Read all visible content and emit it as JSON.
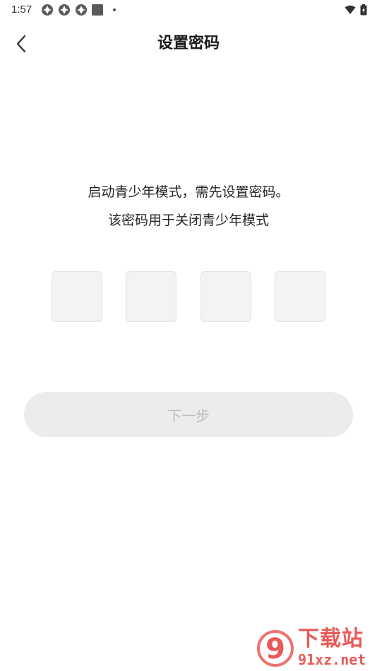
{
  "status_bar": {
    "time": "1:57",
    "notification_icons": [
      "app-notification-icon",
      "app-notification-icon",
      "app-notification-icon",
      "gallery-icon",
      "more-dot-icon"
    ],
    "right_icons": [
      "wifi-icon",
      "battery-charging-icon"
    ]
  },
  "header": {
    "back_icon": "chevron-left-icon",
    "title": "设置密码"
  },
  "description": {
    "line1": "启动青少年模式，需先设置密码。",
    "line2": "该密码用于关闭青少年模式"
  },
  "pin": {
    "length": 4,
    "values": [
      "",
      "",
      "",
      ""
    ]
  },
  "actions": {
    "next_label": "下一步",
    "next_enabled": false
  },
  "watermark": {
    "logo_text": "9",
    "brand": "下载站",
    "url": "91xz.net"
  },
  "colors": {
    "background": "#ffffff",
    "pin_box_fill": "#f3f3f3",
    "button_disabled_fill": "#ececec",
    "button_disabled_text": "#bdbdbd",
    "watermark": "#e85a57"
  }
}
